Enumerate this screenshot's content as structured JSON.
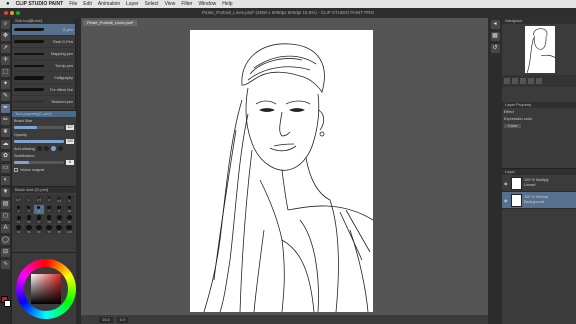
{
  "menubar": {
    "apple": "",
    "app": "CLIP STUDIO PAINT",
    "items": [
      "File",
      "Edit",
      "Animation",
      "Layer",
      "Select",
      "View",
      "Filter",
      "Window",
      "Help"
    ]
  },
  "window": {
    "title": "Pirate_Portrait_Lines.psd* (4500 x 6000px 600dpi 15.5%) - CLIP STUDIO PAINT PRO"
  },
  "canvas_tab": "Pirate_Portrait_Lines.psd*",
  "subtool": {
    "header": "Sub tool[Brush]",
    "brushes": [
      {
        "name": "G-pen",
        "selected": true
      },
      {
        "name": "Real G-Pen",
        "selected": false
      },
      {
        "name": "Mapping pen",
        "selected": false
      },
      {
        "name": "Turnip pen",
        "selected": false
      },
      {
        "name": "Calligraphy",
        "selected": false
      },
      {
        "name": "For effect line",
        "selected": false
      },
      {
        "name": "Textured pen",
        "selected": false
      }
    ]
  },
  "tool_property": {
    "header": "Tool property[G-pen]",
    "brush_size_label": "Brush Size",
    "brush_size": "6.0",
    "opacity_label": "Opacity",
    "opacity": "100",
    "opacity_fraction": 1.0,
    "brush_size_fraction": 0.45,
    "antialiasing_label": "Anti-aliasing",
    "stabilization_label": "Stabilization",
    "stabilization": "8",
    "stabilization_fraction": 0.3,
    "vector_snap_label": "Vector magnet"
  },
  "brush_size_panel": {
    "header": "Brush size [G-pen]",
    "sizes": [
      "0.7",
      "1",
      "1.5",
      "2",
      "2.5",
      "3",
      "4",
      "5",
      "6",
      "7",
      "8",
      "10",
      "12",
      "15",
      "17",
      "20",
      "25",
      "30",
      "40",
      "50",
      "60",
      "70",
      "80",
      "100"
    ],
    "selected": "6"
  },
  "right": {
    "navigator_header": "Navigator",
    "layer_property_header": "Layer Property",
    "effect_label": "Effect",
    "expression_label": "Expression color",
    "color_value": "Color",
    "layer_header": "Layer",
    "layers": [
      {
        "line1": "100 % Multiply",
        "line2": "Lineart",
        "selected": false
      },
      {
        "line1": "100 % Normal",
        "line2": "Background",
        "selected": true
      }
    ]
  },
  "bottom": {
    "zoom": "15.5",
    "angle": "0.0"
  },
  "colors": {
    "accent": "#56708e",
    "swatch_fg": "#c42020",
    "swatch_bg": "#ffffff"
  }
}
